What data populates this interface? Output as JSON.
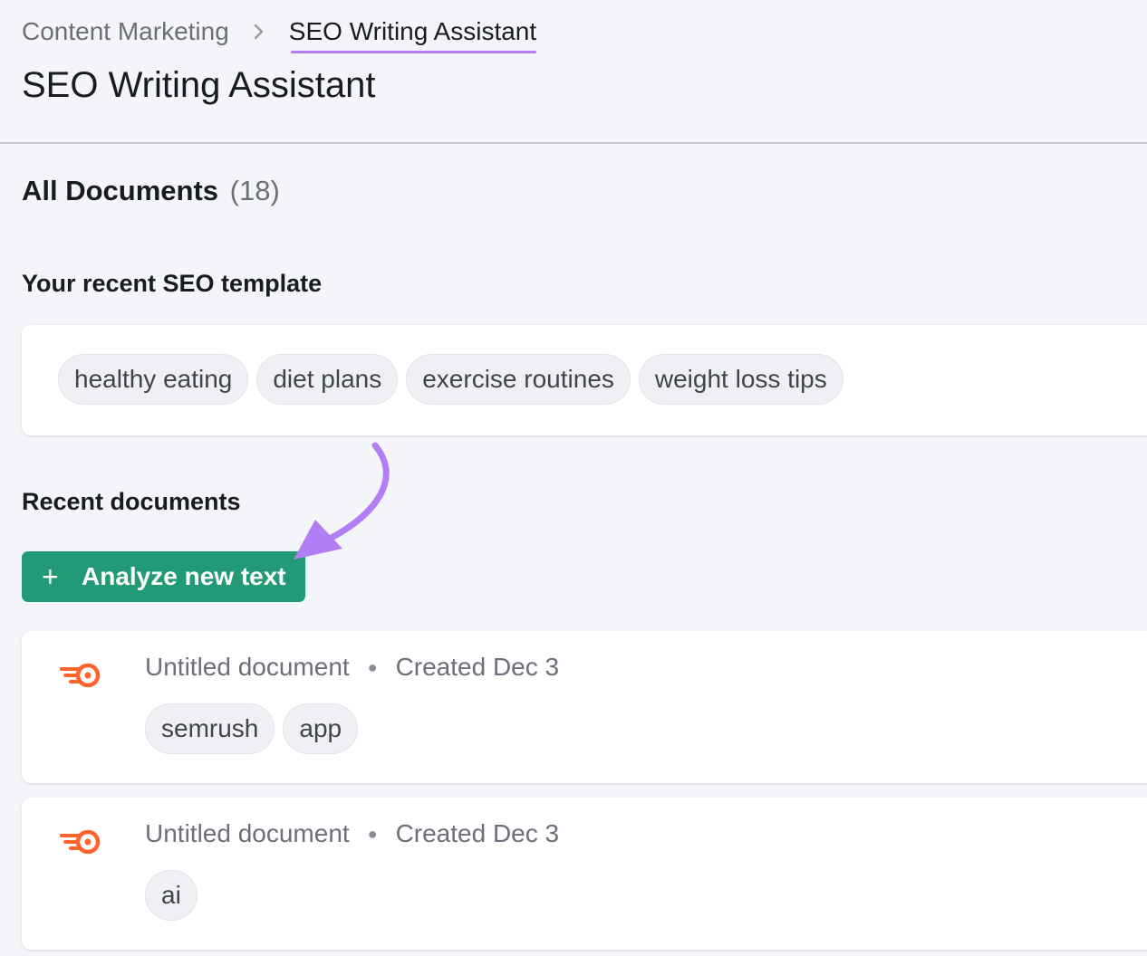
{
  "breadcrumb": {
    "parent": "Content Marketing",
    "current": "SEO Writing Assistant"
  },
  "page_title": "SEO Writing Assistant",
  "all_documents": {
    "label": "All Documents",
    "count": "(18)"
  },
  "template": {
    "heading": "Your recent SEO template",
    "tags": [
      "healthy eating",
      "diet plans",
      "exercise routines",
      "weight loss tips"
    ]
  },
  "recent": {
    "heading": "Recent documents",
    "analyze_button": "Analyze new text",
    "documents": [
      {
        "title": "Untitled document",
        "created": "Created Dec 3",
        "tags": [
          "semrush",
          "app"
        ]
      },
      {
        "title": "Untitled document",
        "created": "Created Dec 3",
        "tags": [
          "ai"
        ]
      }
    ]
  },
  "colors": {
    "accent_purple": "#b27ef5",
    "button_green": "#219a75",
    "logo_orange": "#ff642d"
  },
  "icons": {
    "breadcrumb_separator": "chevron-right-icon",
    "button": "plus-icon",
    "document": "semrush-logo-icon"
  }
}
